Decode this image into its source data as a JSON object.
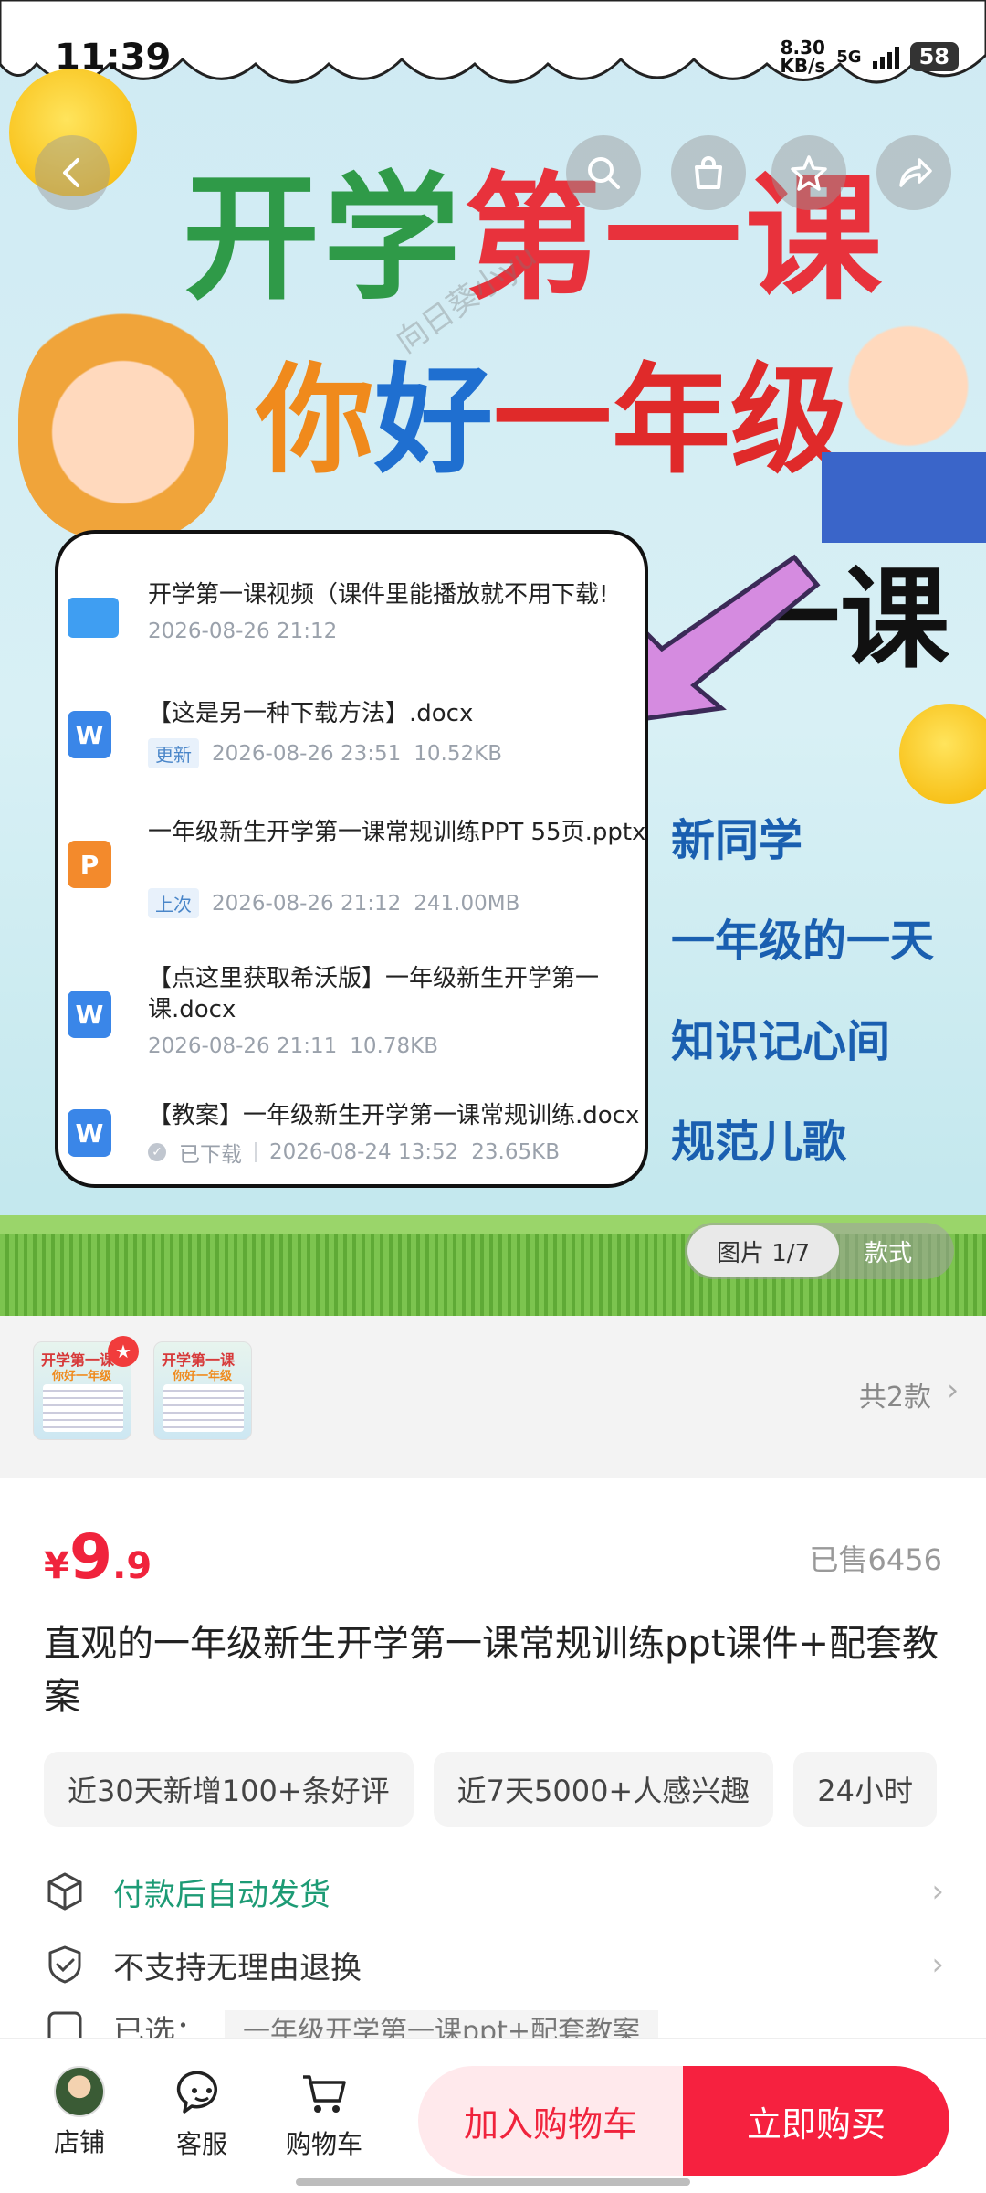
{
  "status_bar": {
    "time": "11:39",
    "speed_value": "8.30",
    "speed_unit": "KB/s",
    "network": "5G",
    "battery": "58"
  },
  "hero": {
    "title_line1_green": "开学",
    "title_line1_red": "第一课",
    "title_line2_orange": "你",
    "title_line2_blue": "好",
    "title_line2_red": "一年级",
    "watermark": "向日葵小yu",
    "side_big": "一课",
    "side_lines": [
      "新同学",
      "一年级的一天",
      "知识记心间",
      "规范儿歌"
    ],
    "image_counter": "图片 1/7",
    "style_label": "款式"
  },
  "file_card": {
    "files": [
      {
        "type": "folder",
        "name": "开学第一课视频（课件里能播放就不用下载!",
        "tag": "",
        "date": "2026-08-26  21:12",
        "size": ""
      },
      {
        "type": "word",
        "name": "【这是另一种下载方法】.docx",
        "tag": "更新",
        "date": "2026-08-26  23:51",
        "size": "10.52KB"
      },
      {
        "type": "ppt",
        "name": "一年级新生开学第一课常规训练PPT 55页.pptx",
        "tag": "上次",
        "date": "2026-08-26  21:12",
        "size": "241.00MB"
      },
      {
        "type": "word",
        "name": "【点这里获取希沃版】一年级新生开学第一课.docx",
        "tag": "",
        "date": "2026-08-26  21:11",
        "size": "10.78KB"
      },
      {
        "type": "word",
        "name": "【教案】一年级新生开学第一课常规训练.docx",
        "tag": "已下载",
        "date": "2026-08-24  13:52",
        "size": "23.65KB"
      }
    ]
  },
  "variants": {
    "thumb_title": "开学第一课",
    "thumb_sub": "你好一年级",
    "total": "共2款"
  },
  "product": {
    "currency": "¥",
    "price_int": "9",
    "price_dec": ".9",
    "sold": "已售6456",
    "title": "直观的一年级新生开学第一课常规训练ppt课件+配套教案",
    "tags": [
      "近30天新增100+条好评",
      "近7天5000+人感兴趣",
      "24小时"
    ]
  },
  "services": {
    "auto_delivery": "付款后自动发货",
    "no_return": "不支持无理由退换",
    "selected_label": "已选：",
    "selected_value": "一年级开学第一课ppt+配套教案"
  },
  "bottom_bar": {
    "store": "店铺",
    "service": "客服",
    "cart": "购物车",
    "add_to_cart": "加入购物车",
    "buy_now": "立即购买"
  },
  "colors": {
    "accent_red": "#f6213f",
    "price_red": "#f0233c",
    "service_green": "#1d9b75"
  }
}
